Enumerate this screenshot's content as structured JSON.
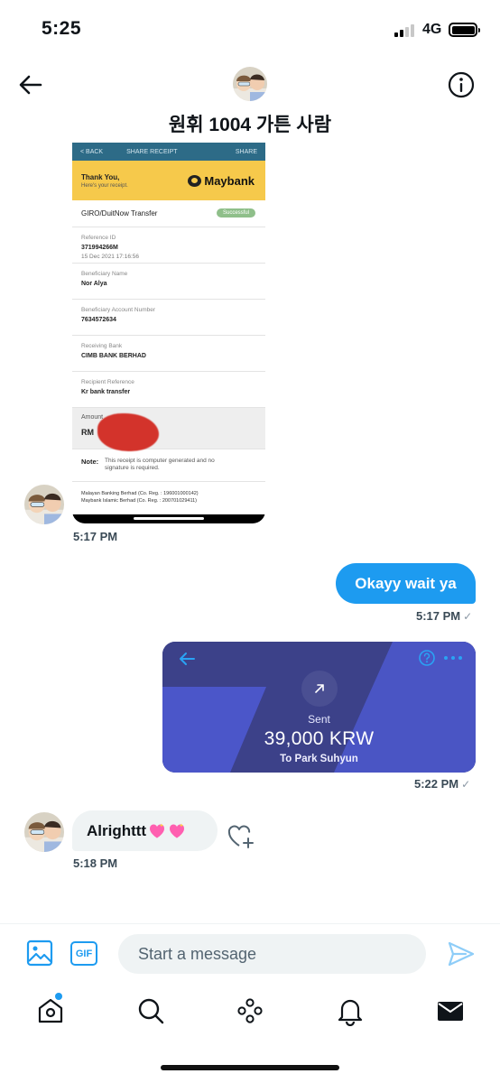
{
  "status_bar": {
    "time": "5:25",
    "network": "4G"
  },
  "header": {
    "title": "원휘 1004 가튼 사람"
  },
  "receipt": {
    "top_back": "< BACK",
    "top_title": "SHARE RECEIPT",
    "top_share": "SHARE",
    "thank_you": "Thank You,",
    "here_is": "Here's your receipt.",
    "brand": "Maybank",
    "transfer_type": "GIRO/DuitNow Transfer",
    "status": "Successful",
    "fields": [
      {
        "label": "Reference ID",
        "value": "371994266M",
        "detail": "15 Dec 2021 17:16:56"
      },
      {
        "label": "Beneficiary Name",
        "value": "Nor Alya",
        "detail": ""
      },
      {
        "label": "Beneficiary Account Number",
        "value": "7634572634",
        "detail": ""
      },
      {
        "label": "Receiving Bank",
        "value": "CIMB BANK BERHAD",
        "detail": ""
      },
      {
        "label": "Recipient Reference",
        "value": "Kr bank transfer",
        "detail": ""
      }
    ],
    "amount_label": "Amount",
    "amount_value": "RM",
    "note_label": "Note:",
    "note_text": "This receipt is computer generated and no signature is required.",
    "legal_1": "Malayan Banking Berhad (Co. Reg. : 196001000142)",
    "legal_2": "Maybank Islamic Berhad (Co. Reg. : 200701029411)"
  },
  "messages": {
    "receipt_time": "5:17 PM",
    "sent_text": "Okayy wait ya",
    "sent_time": "5:17 PM",
    "payment_time": "5:22 PM",
    "recv_text": "Alrighttt",
    "recv_time": "5:18 PM"
  },
  "payment": {
    "status": "Sent",
    "amount": "39,000 KRW",
    "recipient": "To Park Suhyun"
  },
  "composer": {
    "placeholder": "Start a message",
    "gif_label": "GIF"
  },
  "colors": {
    "accent": "#1d9bf0",
    "payment_bg": "#3b3f8c",
    "payment_band": "#4b56c9"
  },
  "icons": [
    "back-arrow-icon",
    "info-icon",
    "heart-plus-icon",
    "image-icon",
    "send-icon",
    "home-icon",
    "search-icon",
    "spaces-icon",
    "bell-icon",
    "mail-icon"
  ]
}
